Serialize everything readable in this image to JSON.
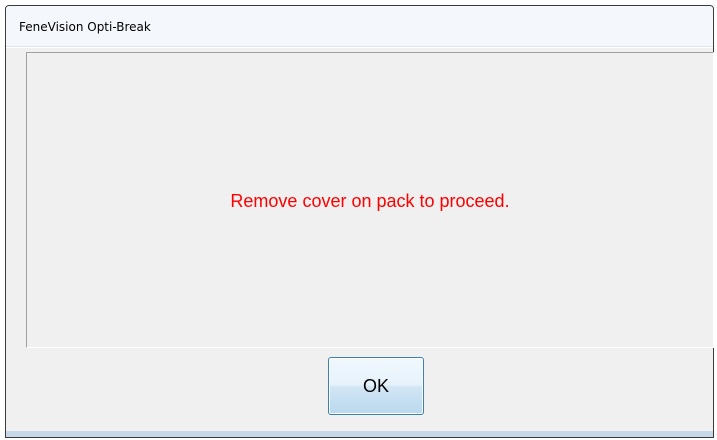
{
  "window": {
    "title": "FeneVision Opti-Break"
  },
  "message": {
    "text": "Remove cover on pack to proceed.",
    "color": "#ff0000"
  },
  "buttons": {
    "ok_label": "OK"
  },
  "colors": {
    "frame": "#c6d7ea",
    "client": "#f0f0f0",
    "button_border": "#3c7fb1"
  }
}
